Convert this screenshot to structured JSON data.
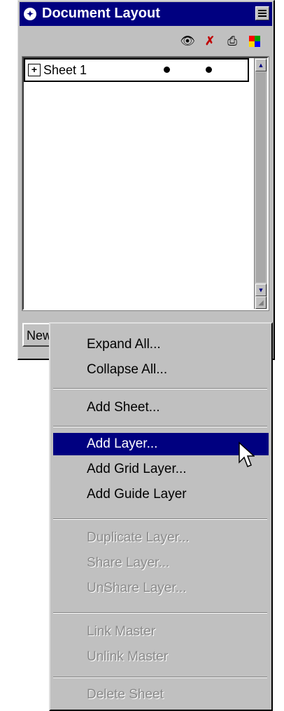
{
  "window": {
    "title": "Document Layout"
  },
  "toolbar": {
    "icons": [
      "eye-icon",
      "lock-icon",
      "print-icon",
      "color-icon"
    ]
  },
  "sheet_list": {
    "rows": [
      {
        "label": "Sheet 1",
        "expand_symbol": "+"
      }
    ]
  },
  "bottom": {
    "new_label": "New"
  },
  "menu": {
    "items": [
      {
        "label": "Expand All...",
        "enabled": true
      },
      {
        "label": "Collapse All...",
        "enabled": true
      },
      {
        "label": "Add Sheet...",
        "enabled": true
      },
      {
        "label": "Add Layer...",
        "enabled": true,
        "highlighted": true
      },
      {
        "label": "Add Grid Layer...",
        "enabled": true
      },
      {
        "label": "Add Guide Layer",
        "enabled": true
      },
      {
        "label": "Duplicate Layer...",
        "enabled": false
      },
      {
        "label": "Share Layer...",
        "enabled": false
      },
      {
        "label": "UnShare Layer...",
        "enabled": false
      },
      {
        "label": "Link Master",
        "enabled": false
      },
      {
        "label": "Unlink Master",
        "enabled": false
      },
      {
        "label": "Delete Sheet",
        "enabled": false
      }
    ]
  },
  "colors": {
    "titlebar": "#000080",
    "face": "#c0c0c0",
    "highlight": "#000080"
  }
}
